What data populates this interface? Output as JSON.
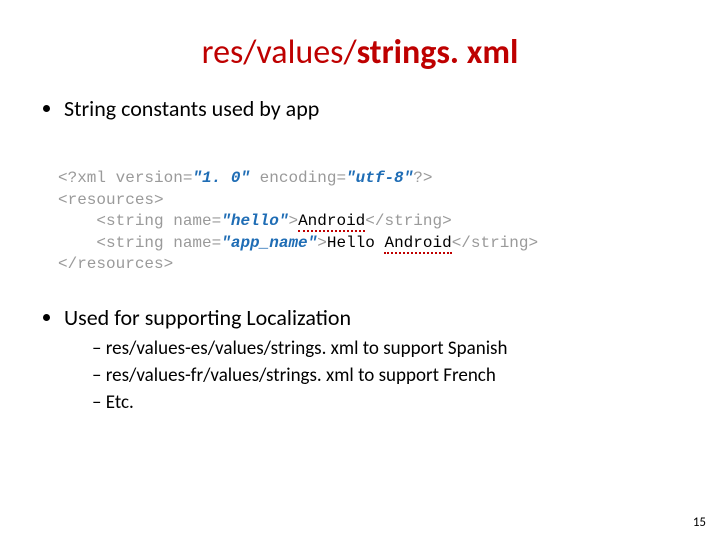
{
  "title": {
    "pre": "res/values/",
    "bold": "strings. xml"
  },
  "bullets": {
    "b1": "String constants used by app",
    "b2": "Used for supporting Localization",
    "sub1": "res/values-es/values/strings. xml to support Spanish",
    "sub2": "res/values-fr/values/strings. xml to support French",
    "sub3": "Etc."
  },
  "code": {
    "l1a": "<?xml version=",
    "l1b": "\"1. 0\"",
    "l1c": " encoding=",
    "l1d": "\"utf-8\"",
    "l1e": "?>",
    "l2": "<resources>",
    "l3a": "    <string name=",
    "l3b": "\"hello\"",
    "l3c": ">",
    "l3d": "Android",
    "l3e": "</string>",
    "l4a": "    <string name=",
    "l4b": "\"app_name\"",
    "l4c": ">",
    "l4d": "Hello ",
    "l4e": "Android",
    "l4f": "</string>",
    "l5": "</resources>"
  },
  "pagenum": "15"
}
